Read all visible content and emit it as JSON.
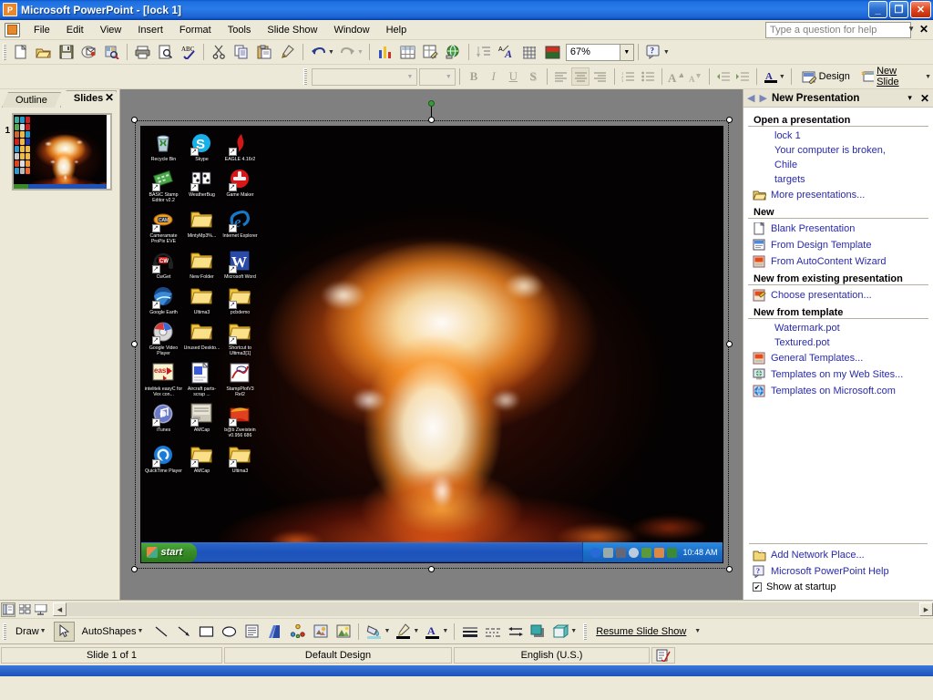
{
  "window": {
    "app_name": "Microsoft PowerPoint",
    "document_title": "[lock 1]",
    "title_full": "Microsoft PowerPoint - [lock 1]",
    "minimize_label": "_",
    "restore_label": "❐",
    "close_label": "✕"
  },
  "menu": {
    "items": [
      {
        "label": "File"
      },
      {
        "label": "Edit"
      },
      {
        "label": "View"
      },
      {
        "label": "Insert"
      },
      {
        "label": "Format"
      },
      {
        "label": "Tools"
      },
      {
        "label": "Slide Show"
      },
      {
        "label": "Window"
      },
      {
        "label": "Help"
      }
    ],
    "help_question_placeholder": "Type a question for help",
    "help_close_label": "✕"
  },
  "standard_toolbar": {
    "buttons": [
      {
        "name": "new-document",
        "label": "New"
      },
      {
        "name": "open",
        "label": "Open"
      },
      {
        "name": "save",
        "label": "Save"
      },
      {
        "name": "email",
        "label": "E-mail"
      },
      {
        "name": "search",
        "label": "Search"
      },
      {
        "name": "print",
        "label": "Print"
      },
      {
        "name": "print-preview",
        "label": "Print Preview"
      },
      {
        "name": "spelling",
        "label": "Spelling"
      },
      {
        "name": "cut",
        "label": "Cut"
      },
      {
        "name": "copy",
        "label": "Copy"
      },
      {
        "name": "paste",
        "label": "Paste"
      },
      {
        "name": "format-painter",
        "label": "Format Painter"
      },
      {
        "name": "undo",
        "label": "Undo"
      },
      {
        "name": "redo",
        "label": "Redo"
      },
      {
        "name": "insert-chart",
        "label": "Insert Chart"
      },
      {
        "name": "insert-table",
        "label": "Insert Table"
      },
      {
        "name": "tables-and-borders",
        "label": "Tables and Borders"
      },
      {
        "name": "insert-hyperlink",
        "label": "Insert Hyperlink"
      },
      {
        "name": "expand-all",
        "label": "Expand All"
      },
      {
        "name": "show-formatting",
        "label": "Show Formatting"
      },
      {
        "name": "show-grid",
        "label": "Show Grid"
      },
      {
        "name": "color-grayscale",
        "label": "Color/Grayscale"
      }
    ],
    "zoom_value": "67%",
    "help_label": "Microsoft PowerPoint Help"
  },
  "formatting_toolbar": {
    "font_name": "",
    "font_size": "",
    "bold_label": "B",
    "italic_label": "I",
    "underline_label": "U",
    "shadow_label": "S",
    "design_label": "Design",
    "new_slide_label": "New Slide"
  },
  "left_pane": {
    "tabs": [
      {
        "label": "Outline",
        "active": false
      },
      {
        "label": "Slides",
        "active": true
      }
    ],
    "close_label": "✕",
    "slide_number": "1"
  },
  "slide": {
    "desktop_icons": [
      {
        "label": "Recycle Bin",
        "icon": "recycle-bin-icon",
        "shortcut": false
      },
      {
        "label": "Skype",
        "icon": "skype-icon",
        "shortcut": true
      },
      {
        "label": "EAGLE 4.16r2",
        "icon": "eagle-icon",
        "shortcut": true
      },
      {
        "label": "BASIC Stamp Editor v2.2",
        "icon": "basic-stamp-icon",
        "shortcut": true
      },
      {
        "label": "WeatherBug",
        "icon": "weatherbug-icon",
        "shortcut": true
      },
      {
        "label": "Game Maker",
        "icon": "game-maker-icon",
        "shortcut": true
      },
      {
        "label": "Cameramate ProPix EVE",
        "icon": "cameramate-icon",
        "shortcut": true
      },
      {
        "label": "MintyMp3%...",
        "icon": "folder-icon",
        "shortcut": false
      },
      {
        "label": "Internet Explorer",
        "icon": "internet-explorer-icon",
        "shortcut": true
      },
      {
        "label": "CwGet",
        "icon": "cwget-icon",
        "shortcut": true
      },
      {
        "label": "New Folder",
        "icon": "folder-icon",
        "shortcut": false
      },
      {
        "label": "Microsoft Word",
        "icon": "microsoft-word-icon",
        "shortcut": true
      },
      {
        "label": "Google Earth",
        "icon": "google-earth-icon",
        "shortcut": true
      },
      {
        "label": "Ultima3",
        "icon": "folder-icon",
        "shortcut": false
      },
      {
        "label": "pcbdemo",
        "icon": "folder-shortcut-icon",
        "shortcut": true
      },
      {
        "label": "Google Video Player",
        "icon": "google-video-player-icon",
        "shortcut": true
      },
      {
        "label": "Unused Deskto...",
        "icon": "folder-icon",
        "shortcut": false
      },
      {
        "label": "Shortcut to Ultima3[1]",
        "icon": "folder-shortcut-icon",
        "shortcut": true
      },
      {
        "label": "intelitek easyC for Vex con...",
        "icon": "easyc-icon",
        "shortcut": false
      },
      {
        "label": "Aircraft parts-scrap ...",
        "icon": "document-icon",
        "shortcut": false
      },
      {
        "label": "StampPlotV3 Rel2",
        "icon": "stampplot-icon",
        "shortcut": false
      },
      {
        "label": "iTunes",
        "icon": "itunes-icon",
        "shortcut": true
      },
      {
        "label": "AMCap",
        "icon": "amcap-icon",
        "shortcut": true
      },
      {
        "label": "b@b Zweistein v0.956 686",
        "icon": "zweistein-icon",
        "shortcut": true
      },
      {
        "label": "QuickTime Player",
        "icon": "quicktime-icon",
        "shortcut": true
      },
      {
        "label": "AMCap",
        "icon": "folder-shortcut-icon",
        "shortcut": true
      },
      {
        "label": "Ultima3",
        "icon": "folder-shortcut-icon",
        "shortcut": true
      }
    ],
    "taskbar": {
      "start_label": "start",
      "clock": "10:48 AM"
    },
    "image_description": "nuclear explosion mushroom cloud"
  },
  "task_pane": {
    "title": "New Presentation",
    "back_label": "◀",
    "forward_label": "▶",
    "dropdown_label": "▾",
    "close_label": "✕",
    "sections": [
      {
        "title": "Open a presentation",
        "items": [
          {
            "label": "lock 1",
            "indent": true,
            "icon": null
          },
          {
            "label": "Your computer is broken,",
            "indent": true,
            "icon": null
          },
          {
            "label": "Chile",
            "indent": true,
            "icon": null
          },
          {
            "label": "targets",
            "indent": true,
            "icon": null
          },
          {
            "label": "More presentations...",
            "indent": false,
            "icon": "open-folder-icon"
          }
        ]
      },
      {
        "title": "New",
        "items": [
          {
            "label": "Blank Presentation",
            "indent": false,
            "icon": "blank-page-icon"
          },
          {
            "label": "From Design Template",
            "indent": false,
            "icon": "design-template-icon"
          },
          {
            "label": "From AutoContent Wizard",
            "indent": false,
            "icon": "autocontent-wizard-icon"
          }
        ]
      },
      {
        "title": "New from existing presentation",
        "items": [
          {
            "label": "Choose presentation...",
            "indent": false,
            "icon": "choose-presentation-icon"
          }
        ]
      },
      {
        "title": "New from template",
        "items": [
          {
            "label": "Watermark.pot",
            "indent": true,
            "icon": null
          },
          {
            "label": "Textured.pot",
            "indent": true,
            "icon": null
          },
          {
            "label": "General Templates...",
            "indent": false,
            "icon": "general-templates-icon"
          },
          {
            "label": "Templates on my Web Sites...",
            "indent": false,
            "icon": "web-templates-icon"
          },
          {
            "label": "Templates on Microsoft.com",
            "indent": false,
            "icon": "microsoft-templates-icon"
          }
        ]
      }
    ],
    "bottom_items": [
      {
        "label": "Add Network Place...",
        "icon": "add-network-place-icon"
      },
      {
        "label": "Microsoft PowerPoint Help",
        "icon": "help-question-icon"
      }
    ],
    "show_at_startup_label": "Show at startup",
    "show_at_startup_checked": true
  },
  "view_bar": {
    "buttons": [
      {
        "name": "normal-view",
        "label": "Normal View",
        "active": true
      },
      {
        "name": "slide-sorter-view",
        "label": "Slide Sorter View",
        "active": false
      },
      {
        "name": "slide-show-view",
        "label": "Slide Show",
        "active": false
      }
    ]
  },
  "drawing_toolbar": {
    "draw_label": "Draw",
    "autoshapes_label": "AutoShapes",
    "resume_slide_show_label": "Resume Slide Show",
    "buttons": [
      {
        "name": "select-objects",
        "label": "Select Objects"
      },
      {
        "name": "line",
        "label": "Line"
      },
      {
        "name": "arrow",
        "label": "Arrow"
      },
      {
        "name": "rectangle",
        "label": "Rectangle"
      },
      {
        "name": "oval",
        "label": "Oval"
      },
      {
        "name": "text-box",
        "label": "Text Box"
      },
      {
        "name": "insert-wordart",
        "label": "Insert WordArt"
      },
      {
        "name": "insert-diagram",
        "label": "Insert Diagram or Organization Chart"
      },
      {
        "name": "insert-clip-art",
        "label": "Insert Clip Art"
      },
      {
        "name": "insert-picture",
        "label": "Insert Picture"
      },
      {
        "name": "fill-color",
        "label": "Fill Color"
      },
      {
        "name": "line-color",
        "label": "Line Color"
      },
      {
        "name": "font-color",
        "label": "Font Color"
      },
      {
        "name": "line-style",
        "label": "Line Style"
      },
      {
        "name": "dash-style",
        "label": "Dash Style"
      },
      {
        "name": "arrow-style",
        "label": "Arrow Style"
      },
      {
        "name": "shadow-style",
        "label": "Shadow Style"
      },
      {
        "name": "3d-style",
        "label": "3-D Style"
      }
    ]
  },
  "status_bar": {
    "slide_position": "Slide 1 of 1",
    "design": "Default Design",
    "language": "English (U.S.)"
  },
  "colors": {
    "title_blue": "#1d6ee0",
    "toolbar_bg": "#ece9d8",
    "link_blue": "#2a2aa8",
    "editor_gray": "#808080",
    "taskbar_blue": "#1c52ba",
    "start_green": "#378c28"
  }
}
